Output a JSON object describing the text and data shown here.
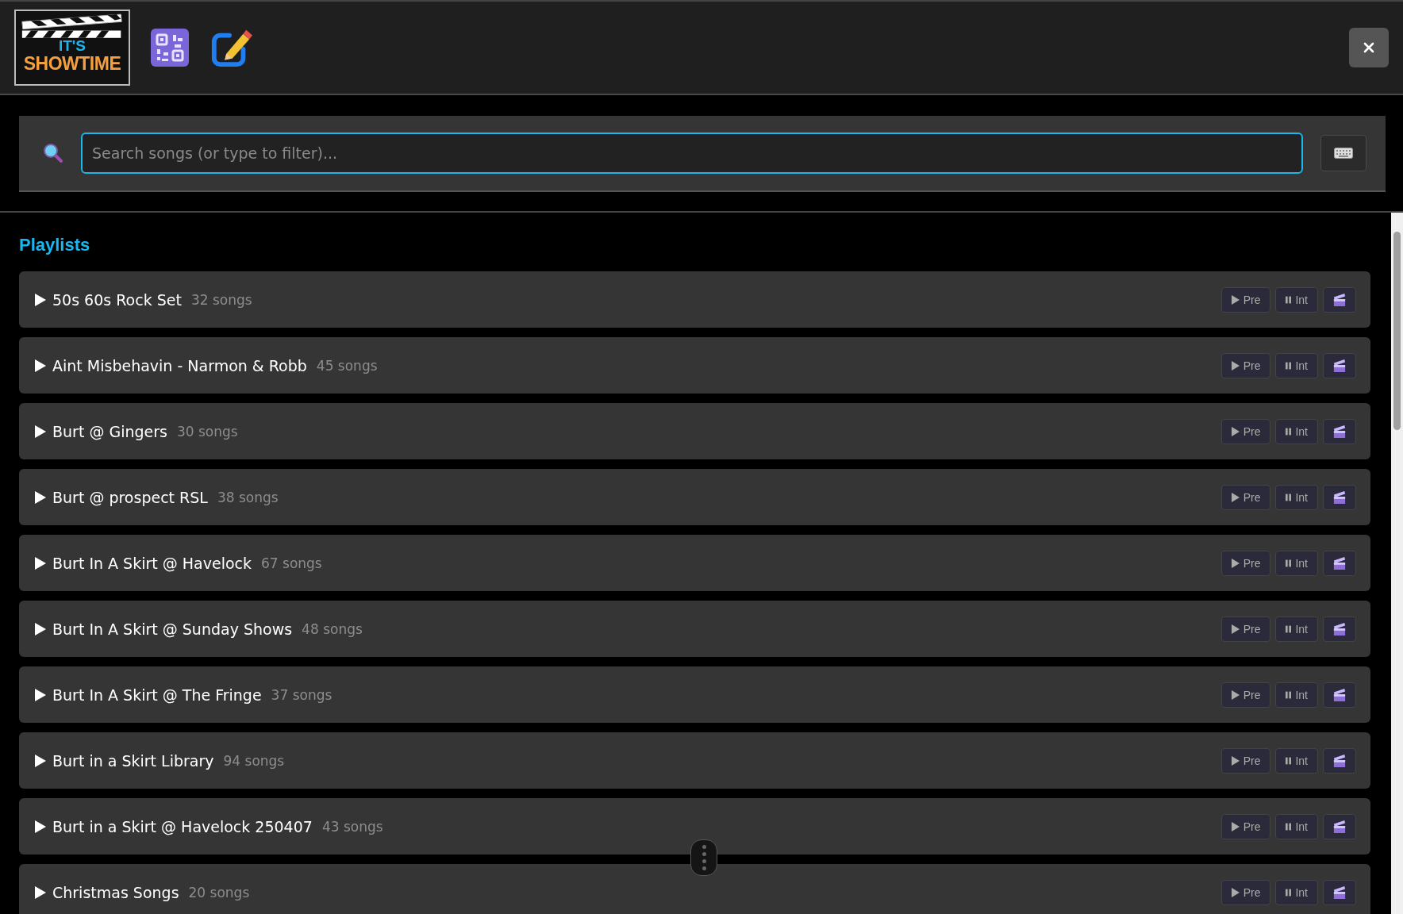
{
  "header": {
    "logo": {
      "line_1": "IT'S",
      "line_2": "SHOWTIME"
    }
  },
  "search": {
    "placeholder": "Search songs (or type to filter)..."
  },
  "section_title": "Playlists",
  "playlists": [
    {
      "name": "50s 60s Rock Set",
      "count": "32 songs",
      "expanded": false,
      "pre": "Pre",
      "int": "Int"
    },
    {
      "name": "Aint Misbehavin - Narmon & Robb",
      "count": "45 songs",
      "expanded": false,
      "pre": "Pre",
      "int": "Int"
    },
    {
      "name": "Burt @ Gingers",
      "count": "30 songs",
      "expanded": false,
      "pre": "Pre",
      "int": "Int"
    },
    {
      "name": "Burt @ prospect RSL",
      "count": "38 songs",
      "expanded": false,
      "pre": "Pre",
      "int": "Int"
    },
    {
      "name": "Burt In A Skirt @ Havelock",
      "count": "67 songs",
      "expanded": false,
      "pre": "Pre",
      "int": "Int"
    },
    {
      "name": "Burt In A Skirt @ Sunday Shows",
      "count": "48 songs",
      "expanded": false,
      "pre": "Pre",
      "int": "Int"
    },
    {
      "name": "Burt In A Skirt @ The Fringe",
      "count": "37 songs",
      "expanded": false,
      "pre": "Pre",
      "int": "Int"
    },
    {
      "name": "Burt in a Skirt Library",
      "count": "94 songs",
      "expanded": false,
      "pre": "Pre",
      "int": "Int"
    },
    {
      "name": "Burt in a Skirt @ Havelock 250407",
      "count": "43 songs",
      "expanded": false,
      "pre": "Pre",
      "int": "Int"
    },
    {
      "name": "Christmas Songs",
      "count": "20 songs",
      "expanded": false,
      "pre": "Pre",
      "int": "Int"
    }
  ]
}
